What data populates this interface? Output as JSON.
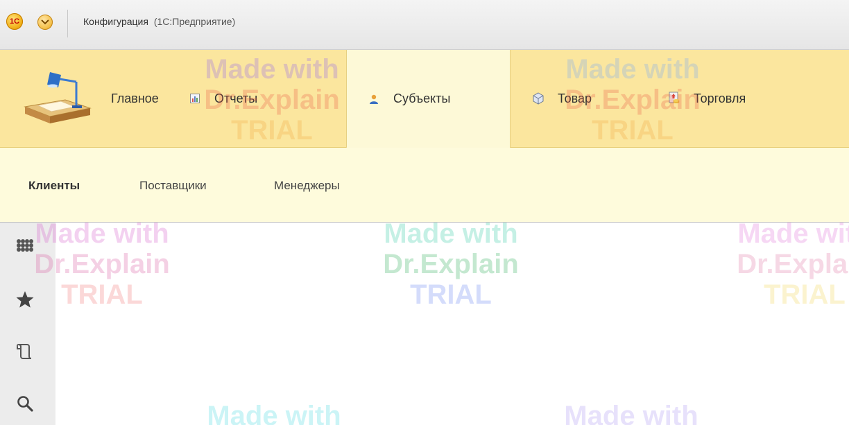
{
  "window": {
    "logo_text": "1C",
    "title": "Конфигурация",
    "subtitle": "(1С:Предприятие)"
  },
  "sections": {
    "items": [
      {
        "label": "Главное",
        "icon": "desk-lamp-icon"
      },
      {
        "label": "Отчеты",
        "icon": "report-icon"
      },
      {
        "label": "Субъекты",
        "icon": "person-icon",
        "active": true
      },
      {
        "label": "Товар",
        "icon": "box-icon"
      },
      {
        "label": "Торговля",
        "icon": "trade-icon"
      }
    ]
  },
  "function_panel": {
    "items": [
      {
        "label": "Клиенты",
        "active": true
      },
      {
        "label": "Поставщики"
      },
      {
        "label": "Менеджеры"
      }
    ]
  },
  "tool_panel": {
    "items": [
      {
        "icon": "grid-icon"
      },
      {
        "icon": "star-icon"
      },
      {
        "icon": "history-icon"
      },
      {
        "icon": "search-icon"
      }
    ]
  },
  "watermark": {
    "line1": "Made with",
    "line2": "Dr.Explain",
    "line3": "TRIAL"
  },
  "colors": {
    "sections_bg": "#fbe69e",
    "active_section_bg": "#fdf9d7",
    "function_panel_bg": "#fefbdc"
  }
}
